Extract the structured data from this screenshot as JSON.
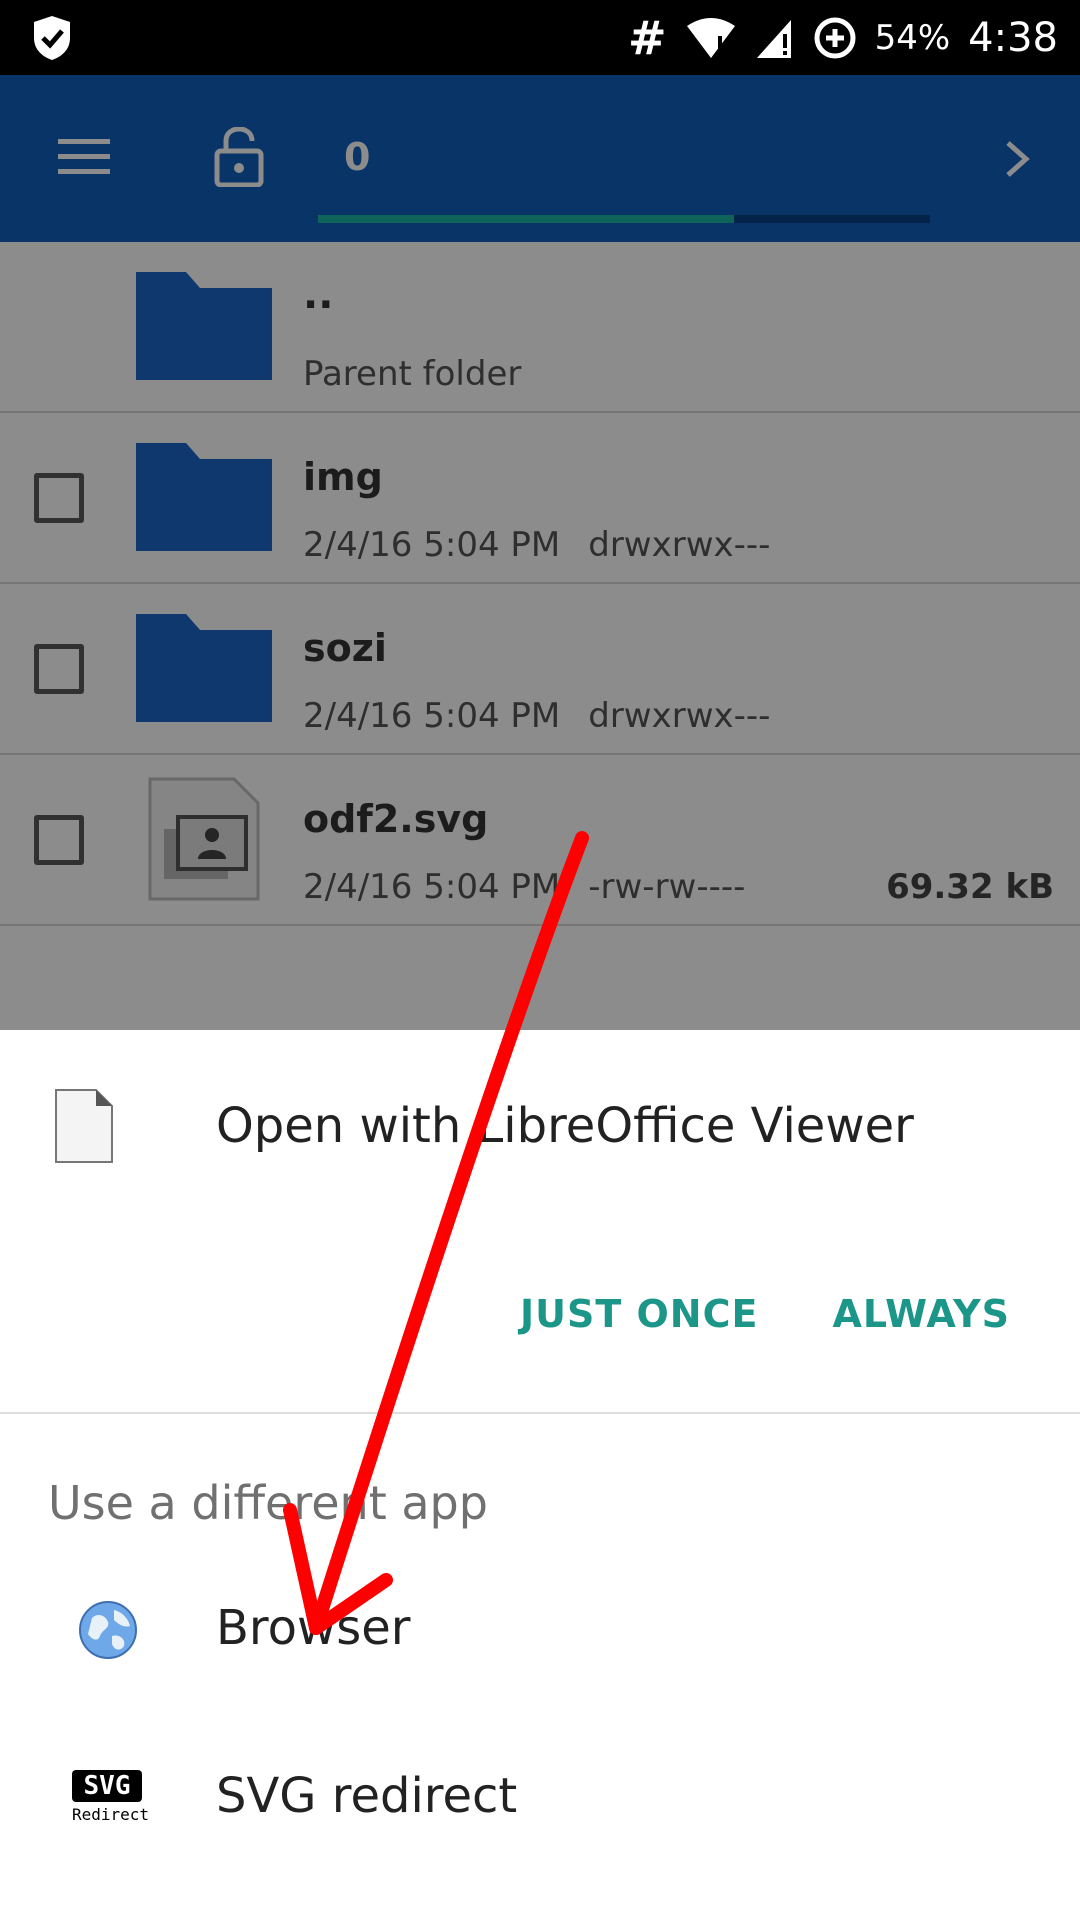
{
  "status_bar": {
    "hash": "#",
    "battery_percent": "54%",
    "time": "4:38",
    "icons": [
      "shield-icon",
      "wifi-icon",
      "signal-icon",
      "data-saver-icon"
    ]
  },
  "app_bar": {
    "selected_count": "0",
    "progress": 0.68,
    "icons": [
      "menu-icon",
      "lock-icon",
      "chevron-right-icon"
    ]
  },
  "files": {
    "parent": {
      "name": "..",
      "subtitle": "Parent folder"
    },
    "items": [
      {
        "name": "img",
        "date": "2/4/16 5:04 PM",
        "perms": "drwxrwx---",
        "size": ""
      },
      {
        "name": "sozi",
        "date": "2/4/16 5:04 PM",
        "perms": "drwxrwx---",
        "size": ""
      },
      {
        "name": "odf2.svg",
        "date": "2/4/16 5:04 PM",
        "perms": "-rw-rw----",
        "size": "69.32 kB"
      }
    ]
  },
  "sheet": {
    "open_with": "Open with LibreOffice Viewer",
    "just_once": "JUST ONCE",
    "always": "ALWAYS",
    "use_different": "Use a different app",
    "apps": [
      {
        "label": "Browser",
        "icon": "globe-icon"
      },
      {
        "label": "SVG redirect",
        "icon": "svg-redirect-icon"
      }
    ],
    "svg_badge_top": "SVG",
    "svg_badge_bottom": "Redirect"
  },
  "colors": {
    "app_bar": "#0f5fbd",
    "accent": "#1b9688",
    "folder": "#1a66c9",
    "annotation": "#ff0000"
  }
}
